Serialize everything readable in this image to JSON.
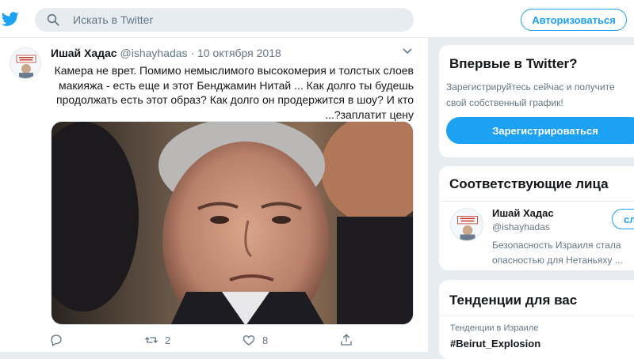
{
  "header": {
    "search_placeholder": "Искать в Twitter",
    "login_label": "Авторизоваться"
  },
  "tweet": {
    "author_name": "Ишай Хадас",
    "author_handle": "@ishayhadas",
    "separator": "·",
    "date": "10 октября 2018",
    "text_lines": [
      "Камера не врет. Помимо немыслимого высокомерия и толстых слоев",
      "макияжа - есть еще и этот Бенджамин Нитай ... Как долго ты будешь",
      "продолжать есть этот образ? Как долго он продержится в шоу? И кто",
      "...?заплатит цену"
    ],
    "retweets": "2",
    "likes": "8"
  },
  "signup_card": {
    "title": "Впервые в Twitter?",
    "subtitle": "Зарегистрируйтесь сейчас и получите свой собственный график!",
    "button_label": "Зарегистрироваться"
  },
  "people_card": {
    "title": "Соответствующие лица",
    "name": "Ишай Хадас",
    "handle": "@ishayhadas",
    "bio": "Безопасность Израиля стала опасностью для Нетаньяху ...",
    "follow_label": "сл"
  },
  "trends_card": {
    "title": "Тенденции для вас",
    "meta": "Тенденции в Израиле",
    "tag": "#Beirut_Explosion"
  },
  "colors": {
    "accent": "#1da1f2",
    "background": "#e6ecf0",
    "secondary_text": "#657786"
  }
}
